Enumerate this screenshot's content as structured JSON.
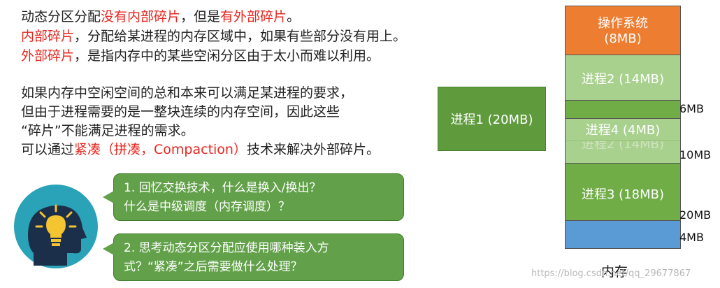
{
  "text": {
    "line1": {
      "a": "动态分区分配",
      "b": "没有内部碎片",
      "c": "，但是",
      "d": "有外部碎片",
      "e": "。"
    },
    "line2": {
      "a": "内部碎片",
      "b": "，分配给某进程的内存区域中，如果有些部分没有用上。"
    },
    "line3": {
      "a": "外部碎片",
      "b": "，是指内存中的某些空闲分区由于太小而难以利用。"
    },
    "para": [
      "如果内存中空闲空间的总和本来可以满足某进程的要求，",
      "但由于进程需要的是一整块连续的内存空间，因此这些",
      "“碎片”不能满足进程的需求。"
    ],
    "line_last": {
      "a": "可以通过",
      "b": "紧凑（拼凑，Compaction）",
      "c": "技术来解决外部碎片。"
    }
  },
  "bubbles": [
    {
      "lines": [
        "1. 回忆交换技术，什么是换入/换出？",
        "什么是中级调度（内存调度）？"
      ]
    },
    {
      "lines": [
        "2. 思考动态分区分配应使用哪种装入方",
        "式？“紧凑”之后需要做什么处理？"
      ]
    }
  ],
  "process1": {
    "label": "进程1 (20MB)"
  },
  "memory": {
    "title": "内存",
    "blocks": [
      {
        "name": "os",
        "label_top": "操作系统",
        "label_bottom": "(8MB)",
        "color": "#ed7d31"
      },
      {
        "name": "process2",
        "label": "进程2 (14MB)",
        "color": "#a9d18e"
      },
      {
        "name": "free-6mb",
        "color": "#70ad47"
      },
      {
        "name": "process4",
        "label": "进程4 (4MB)",
        "color": "#a9d18e"
      },
      {
        "name": "process2-ghost",
        "label": "进程2 (14MB)",
        "color": "#a9d18e"
      },
      {
        "name": "process3",
        "label": "进程3 (18MB)",
        "color": "#70ad47"
      },
      {
        "name": "free-4mb",
        "color": "#5b9bd5"
      }
    ],
    "size_labels": [
      "6MB",
      "10MB",
      "20MB",
      "4MB"
    ]
  },
  "watermark": "https://blog.csdn.net/qq_29677867"
}
